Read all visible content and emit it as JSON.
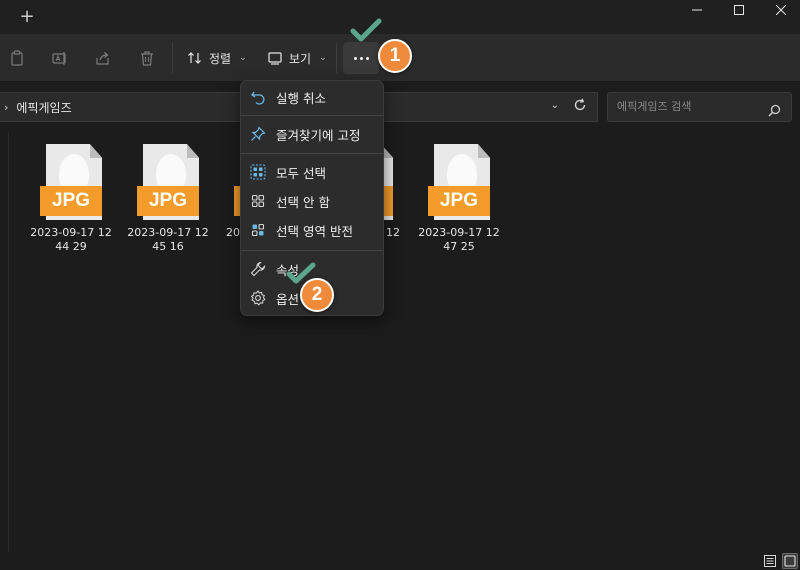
{
  "titlebar": {
    "new_tab_symbol": "+",
    "window_controls": [
      "minimize-icon",
      "maximize-icon",
      "close-icon"
    ]
  },
  "toolbar": {
    "disabled_icons": [
      "copy-icon",
      "rename-icon",
      "share-icon",
      "delete-icon"
    ],
    "sort_label": "정렬",
    "view_label": "보기",
    "more_icon": "ellipsis-icon"
  },
  "address": {
    "path": "에픽게임즈",
    "search_placeholder": "에픽게임즈 검색"
  },
  "files": [
    {
      "line1": "2023-09-17 12",
      "line2": "44 29",
      "type": "JPG"
    },
    {
      "line1": "2023-09-17 12",
      "line2": "45 16",
      "type": "JPG"
    },
    {
      "line1": "20",
      "line2": "",
      "type": "JPG"
    },
    {
      "line1": "12",
      "line2": "",
      "type": "JPG"
    },
    {
      "line1": "2023-09-17 12",
      "line2": "47 25",
      "type": "JPG"
    }
  ],
  "context_menu": {
    "items": [
      {
        "label": "실행 취소",
        "icon": "undo-icon"
      },
      {
        "label": "즐겨찾기에 고정",
        "icon": "pin-icon"
      },
      {
        "label": "모두 선택",
        "icon": "select-all-icon"
      },
      {
        "label": "선택 안 함",
        "icon": "select-none-icon"
      },
      {
        "label": "선택 영역 반전",
        "icon": "invert-selection-icon"
      },
      {
        "label": "속성",
        "icon": "wrench-icon"
      },
      {
        "label": "옵션",
        "icon": "gear-icon"
      }
    ]
  },
  "annotations": {
    "step1": "1",
    "step2": "2",
    "accent_color": "#ef8a3b",
    "check_color": "#5aa58c"
  }
}
